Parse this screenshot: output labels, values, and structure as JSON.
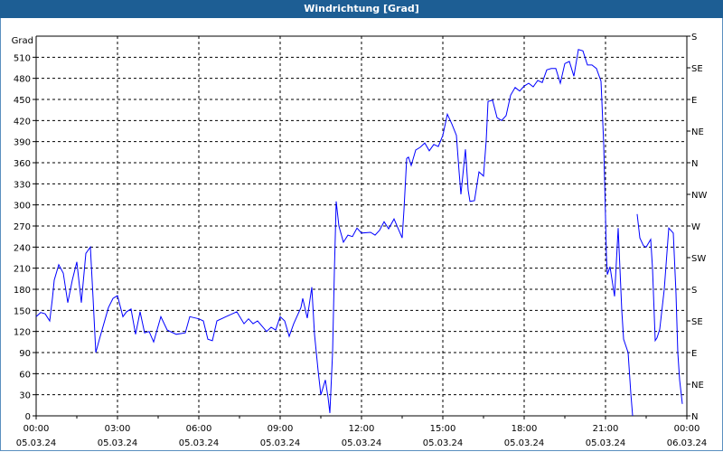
{
  "window": {
    "title": "Windrichtung [Grad]"
  },
  "chart_data": {
    "type": "line",
    "title": "Windrichtung [Grad]",
    "ylabel": "Grad",
    "ylim": [
      0,
      540
    ],
    "yticks": [
      0,
      30,
      60,
      90,
      120,
      150,
      180,
      210,
      240,
      270,
      300,
      330,
      360,
      390,
      420,
      450,
      480,
      510
    ],
    "right_axis": {
      "ticks": [
        0,
        45,
        90,
        135,
        180,
        225,
        270,
        315,
        360,
        405,
        450,
        495,
        540
      ],
      "labels": [
        "N",
        "NE",
        "E",
        "SE",
        "S",
        "SW",
        "W",
        "NW",
        "N",
        "NE",
        "E",
        "SE",
        "S"
      ]
    },
    "xlim_minutes": [
      0,
      1440
    ],
    "xticks": [
      {
        "minutes": 0,
        "time": "00:00",
        "date": "05.03.24"
      },
      {
        "minutes": 180,
        "time": "03:00",
        "date": "05.03.24"
      },
      {
        "minutes": 360,
        "time": "06:00",
        "date": "05.03.24"
      },
      {
        "minutes": 540,
        "time": "09:00",
        "date": "05.03.24"
      },
      {
        "minutes": 720,
        "time": "12:00",
        "date": "05.03.24"
      },
      {
        "minutes": 900,
        "time": "15:00",
        "date": "05.03.24"
      },
      {
        "minutes": 1080,
        "time": "18:00",
        "date": "05.03.24"
      },
      {
        "minutes": 1260,
        "time": "21:00",
        "date": "05.03.24"
      },
      {
        "minutes": 1440,
        "time": "00:00",
        "date": "06.03.24"
      }
    ],
    "grid": true,
    "series": [
      {
        "name": "Windrichtung",
        "color": "#0000ff",
        "x": [
          0,
          10,
          20,
          30,
          36,
          40,
          50,
          60,
          70,
          80,
          90,
          100,
          110,
          120,
          126,
          132,
          140,
          160,
          170,
          180,
          192,
          200,
          210,
          220,
          230,
          240,
          250,
          260,
          276,
          290,
          310,
          330,
          340,
          360,
          370,
          380,
          390,
          400,
          420,
          444,
          460,
          470,
          480,
          490,
          510,
          520,
          530,
          540,
          550,
          560,
          570,
          586,
          590,
          600,
          610,
          616,
          624,
          630,
          640,
          646,
          650,
          656,
          660,
          664,
          670,
          680,
          690,
          700,
          710,
          720,
          740,
          750,
          760,
          770,
          780,
          792,
          810,
          814,
          820,
          824,
          830,
          840,
          850,
          860,
          870,
          880,
          890,
          900,
          910,
          920,
          930,
          936,
          940,
          950,
          956,
          960,
          970,
          980,
          990,
          996,
          1000,
          1010,
          1020,
          1030,
          1040,
          1050,
          1060,
          1070,
          1080,
          1090,
          1100,
          1110,
          1120,
          1130,
          1140,
          1150,
          1160,
          1170,
          1180,
          1190,
          1200,
          1210,
          1220,
          1230,
          1240,
          1250,
          1252,
          1256,
          1260,
          1262,
          1264,
          1270,
          1280,
          1288,
          1296,
          1300,
          1310,
          1316,
          1320,
          1325,
          1330,
          1336,
          1344,
          1350,
          1360,
          1364,
          1370,
          1374,
          1380,
          1390,
          1400,
          1410,
          1416,
          1420,
          1424,
          1430
        ],
        "y": [
          141,
          147,
          145,
          135,
          167,
          193,
          215,
          203,
          161,
          193,
          219,
          161,
          231,
          240,
          167,
          90,
          109,
          154,
          167,
          171,
          141,
          148,
          152,
          116,
          148,
          118,
          120,
          105,
          141,
          122,
          116,
          118,
          141,
          138,
          135,
          109,
          107,
          135,
          141,
          148,
          131,
          138,
          131,
          135,
          120,
          126,
          122,
          141,
          135,
          113,
          131,
          154,
          167,
          139,
          183,
          116,
          64,
          30,
          51,
          26,
          4,
          90,
          206,
          305,
          270,
          247,
          257,
          255,
          267,
          260,
          261,
          257,
          264,
          276,
          266,
          280,
          253,
          293,
          366,
          368,
          356,
          378,
          382,
          388,
          377,
          386,
          383,
          399,
          429,
          415,
          399,
          347,
          315,
          379,
          321,
          305,
          306,
          347,
          341,
          392,
          447,
          449,
          424,
          420,
          427,
          456,
          467,
          462,
          469,
          473,
          468,
          477,
          474,
          492,
          494,
          494,
          473,
          501,
          504,
          483,
          521,
          519,
          499,
          499,
          494,
          476,
          447,
          386,
          283,
          228,
          201,
          212,
          170,
          267,
          150,
          109,
          90,
          32,
          0,
          null,
          287,
          253,
          242,
          240,
          251,
          210,
          107,
          111,
          123,
          180,
          267,
          260,
          174,
          90,
          51,
          17
        ]
      }
    ]
  }
}
